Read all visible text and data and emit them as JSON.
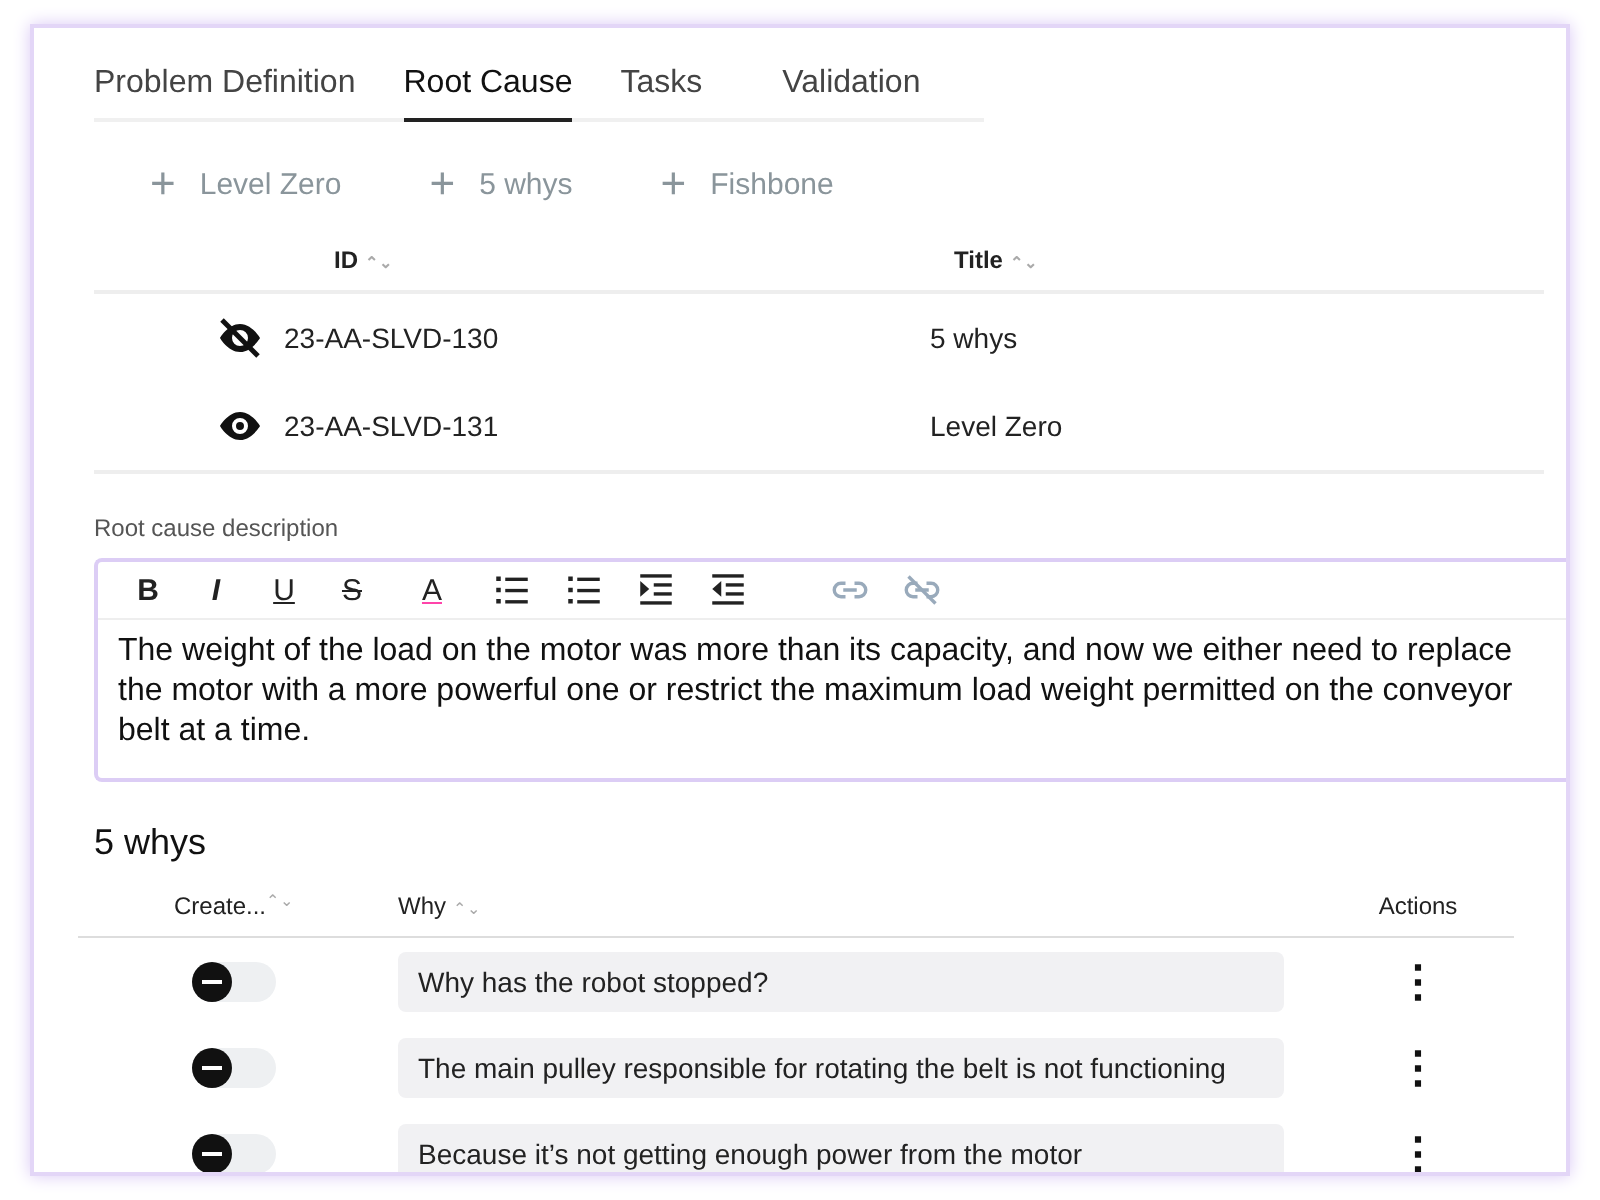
{
  "tabs": [
    {
      "label": "Problem Definition",
      "selected": false
    },
    {
      "label": "Root Cause",
      "selected": true
    },
    {
      "label": "Tasks",
      "selected": false
    },
    {
      "label": "Validation",
      "selected": false
    }
  ],
  "add_buttons": [
    {
      "icon": "+",
      "label": "Level Zero"
    },
    {
      "icon": "+",
      "label": "5 whys"
    },
    {
      "icon": "+",
      "label": "Fishbone"
    }
  ],
  "analyses": {
    "columns": [
      {
        "label": "ID",
        "sort": "⌃⌄"
      },
      {
        "label": "Title",
        "sort": "⌃⌄"
      }
    ],
    "rows": [
      {
        "visible": false,
        "id": "23-AA-SLVD-130",
        "title": "5 whys"
      },
      {
        "visible": true,
        "id": "23-AA-SLVD-131",
        "title": "Level Zero"
      }
    ]
  },
  "description": {
    "label": "Root cause description",
    "toolbar": [
      {
        "kind": "bold",
        "text": "B",
        "disabled": false
      },
      {
        "kind": "italic",
        "text": "I",
        "disabled": false
      },
      {
        "kind": "underline",
        "text": "U",
        "disabled": false
      },
      {
        "kind": "strike",
        "text": "S",
        "disabled": false
      },
      {
        "kind": "color",
        "text": "A",
        "disabled": false
      },
      {
        "kind": "bullets",
        "disabled": false
      },
      {
        "kind": "numbers",
        "disabled": false
      },
      {
        "kind": "indent",
        "disabled": false
      },
      {
        "kind": "outdent",
        "disabled": false
      },
      {
        "kind": "link",
        "disabled": true
      },
      {
        "kind": "unlink",
        "disabled": true
      }
    ],
    "value": "The weight of the load on the motor was more than its capacity, and now we either need to replace the motor with a more powerful one or restrict the maximum load weight permitted on the conveyor belt at a time."
  },
  "whys": {
    "title": "5 whys",
    "columns": [
      {
        "label": "Create...",
        "sort": "⌃⌄"
      },
      {
        "label": "Why",
        "sort": "⌃⌄"
      },
      {
        "label": "Actions"
      }
    ],
    "rows": [
      {
        "on": false,
        "why": "Why has the robot stopped?",
        "menu": "⋮"
      },
      {
        "on": false,
        "why": "The main pulley responsible for rotating the belt is not functioning",
        "menu": "⋮"
      },
      {
        "on": false,
        "why": "Because it’s not getting enough power from the motor",
        "menu": "⋮"
      }
    ]
  }
}
